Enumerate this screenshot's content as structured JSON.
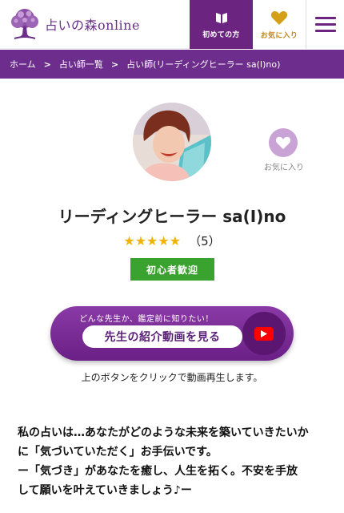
{
  "header": {
    "logo_text": "占いの森online",
    "beginner_label": "初めての方",
    "favorite_label": "お気に入り",
    "menu_icon": "hamburger-icon"
  },
  "breadcrumb": {
    "items": [
      "ホーム",
      "占い師一覧",
      "占い師(リーディングヒーラー sa(I)no)"
    ],
    "separator": ">"
  },
  "profile": {
    "favorite_label": "お気に入り",
    "name": "リーディングヒーラー sa(I)no",
    "stars": "★★★★★",
    "rating": 5,
    "review_count": "（5）",
    "badge": "初心者歓迎"
  },
  "video": {
    "caption": "どんな先生か、鑑定前に知りたい！",
    "button_label": "先生の紹介動画を見る",
    "note": "上のボタンをクリックで動画再生します。"
  },
  "intro": {
    "lines": [
      "私の占いは…あなたがどのような未来を築いていきたいか",
      "に「気づいていただく」お手伝いです。",
      "ー「気づき」があなたを癒し、人生を拓く。不安を手放",
      "して願いを叶えていきましょう♪ー"
    ]
  },
  "colors": {
    "brand_purple": "#6c2d8c",
    "gold": "#c08a1a",
    "badge_green": "#3aa32f",
    "star": "#f0b400"
  }
}
